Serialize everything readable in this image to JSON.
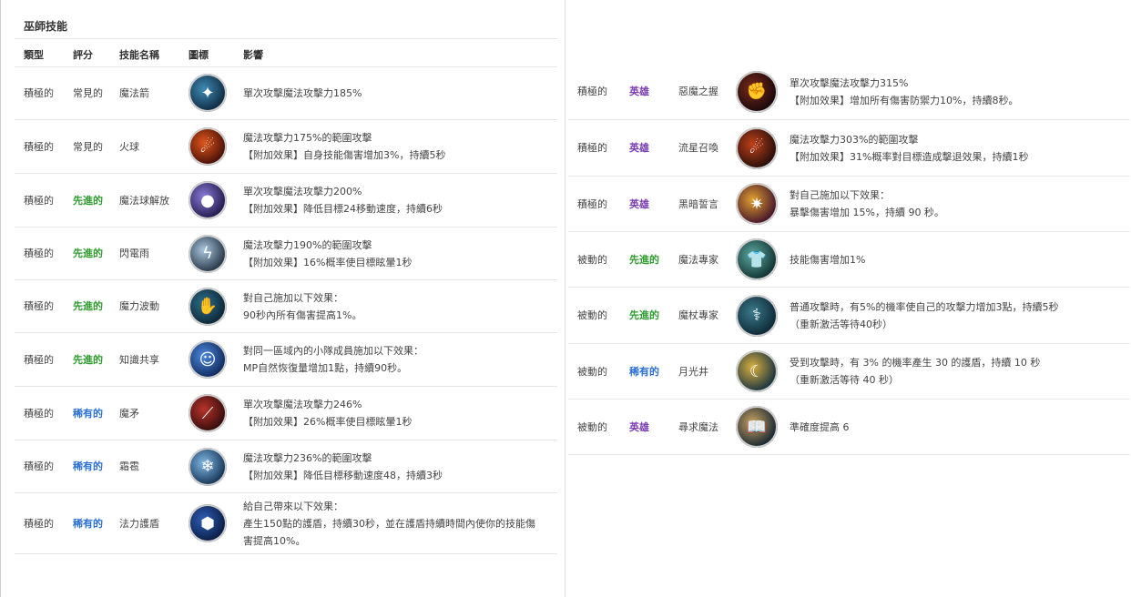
{
  "left": {
    "section_title": "巫師技能",
    "headers": {
      "type": "類型",
      "rating": "評分",
      "name": "技能名稱",
      "icon": "圖標",
      "effect": "影響"
    },
    "rows": [
      {
        "type": "積極的",
        "rarity": "常見的",
        "rarity_class": "common",
        "name": "魔法箭",
        "icon": "magic-arrow-icon",
        "glyph": "✦",
        "colors": [
          "#0c2438",
          "#3d8ab5"
        ],
        "effect": [
          "單次攻擊魔法攻擊力185%"
        ]
      },
      {
        "type": "積極的",
        "rarity": "常見的",
        "rarity_class": "common",
        "name": "火球",
        "icon": "fireball-icon",
        "glyph": "☄",
        "colors": [
          "#3a0a05",
          "#e0561c"
        ],
        "effect": [
          "魔法攻擊力175%的範圍攻擊",
          "【附加效果】自身技能傷害增加3%，持續5秒"
        ]
      },
      {
        "type": "積極的",
        "rarity": "先進的",
        "rarity_class": "advanced",
        "name": "魔法球解放",
        "icon": "magic-orb-release-icon",
        "glyph": "●",
        "colors": [
          "#1a1240",
          "#8a7bd9"
        ],
        "effect": [
          "單次攻擊魔法攻擊力200%",
          "【附加效果】降低目標24移動速度，持續6秒"
        ]
      },
      {
        "type": "積極的",
        "rarity": "先進的",
        "rarity_class": "advanced",
        "name": "閃電雨",
        "icon": "lightning-rain-icon",
        "glyph": "ϟ",
        "colors": [
          "#1b2a3a",
          "#a9c6de"
        ],
        "effect": [
          "魔法攻擊力190%的範圍攻擊",
          "【附加效果】16%概率使目標眩暈1秒"
        ]
      },
      {
        "type": "積極的",
        "rarity": "先進的",
        "rarity_class": "advanced",
        "name": "魔力波動",
        "icon": "mana-wave-icon",
        "glyph": "✋",
        "colors": [
          "#0a2030",
          "#2c6f8a"
        ],
        "effect": [
          "對自己施加以下效果：",
          "90秒內所有傷害提高1%。"
        ]
      },
      {
        "type": "積極的",
        "rarity": "先進的",
        "rarity_class": "advanced",
        "name": "知識共享",
        "icon": "knowledge-share-icon",
        "glyph": "☺",
        "colors": [
          "#0b2250",
          "#4d8ae0"
        ],
        "effect": [
          "對同一區域內的小隊成員施加以下效果：",
          "MP自然恢復量增加1點，持續90秒。"
        ]
      },
      {
        "type": "積極的",
        "rarity": "稀有的",
        "rarity_class": "rare",
        "name": "魔矛",
        "icon": "magic-spear-icon",
        "glyph": "⟋",
        "colors": [
          "#2a0a0a",
          "#b8322a"
        ],
        "effect": [
          "單次攻擊魔法攻擊力246%",
          "【附加效果】26%概率使目標眩暈1秒"
        ]
      },
      {
        "type": "積極的",
        "rarity": "稀有的",
        "rarity_class": "rare",
        "name": "霜雹",
        "icon": "frost-hail-icon",
        "glyph": "❄",
        "colors": [
          "#0e2a4a",
          "#7fb8e6"
        ],
        "effect": [
          "魔法攻擊力236%的範圍攻擊",
          "【附加效果】降低目標移動速度48，持續3秒"
        ]
      },
      {
        "type": "積極的",
        "rarity": "稀有的",
        "rarity_class": "rare",
        "name": "法力護盾",
        "icon": "mana-shield-icon",
        "glyph": "⬢",
        "colors": [
          "#08183a",
          "#2f5fb8"
        ],
        "effect": [
          "給自己帶來以下效果：",
          "產生150點的護盾，持續30秒，並在護盾持續時間內使你的技能傷",
          "害提高10%。"
        ]
      }
    ]
  },
  "right": {
    "rows": [
      {
        "type": "積極的",
        "rarity": "英雄",
        "rarity_class": "hero",
        "name": "惡魔之握",
        "icon": "demon-grip-icon",
        "glyph": "✊",
        "colors": [
          "#12060a",
          "#7a2a1a"
        ],
        "effect": [
          "單次攻擊魔法攻擊力315%",
          "【附加效果】增加所有傷害防禦力10%，持續8秒。"
        ]
      },
      {
        "type": "積極的",
        "rarity": "英雄",
        "rarity_class": "hero",
        "name": "流星召喚",
        "icon": "meteor-summon-icon",
        "glyph": "☄",
        "colors": [
          "#1a0a08",
          "#c0401a"
        ],
        "effect": [
          "魔法攻擊力303%的範圍攻擊",
          "【附加效果】31%概率對目標造成擊退效果，持續1秒"
        ]
      },
      {
        "type": "積極的",
        "rarity": "英雄",
        "rarity_class": "hero",
        "name": "黑暗誓言",
        "icon": "dark-oath-icon",
        "glyph": "✷",
        "colors": [
          "#3a0a2a",
          "#e0a030"
        ],
        "effect": [
          "對自己施加以下效果：",
          "暴擊傷害增加 15%，持續 90 秒。"
        ]
      },
      {
        "type": "被動的",
        "rarity": "先進的",
        "rarity_class": "advanced",
        "name": "魔法專家",
        "icon": "magic-expert-icon",
        "glyph": "👕",
        "colors": [
          "#0a2a2a",
          "#5fa8a0"
        ],
        "effect": [
          "技能傷害增加1%"
        ]
      },
      {
        "type": "被動的",
        "rarity": "先進的",
        "rarity_class": "advanced",
        "name": "魔杖專家",
        "icon": "wand-expert-icon",
        "glyph": "⚕",
        "colors": [
          "#0a2230",
          "#3a7a8a"
        ],
        "effect": [
          "普通攻擊時，有5%的機率使自己的攻擊力增加3點，持續5秒",
          "（重新激活等待40秒）"
        ]
      },
      {
        "type": "被動的",
        "rarity": "稀有的",
        "rarity_class": "rare",
        "name": "月光井",
        "icon": "moonlight-well-icon",
        "glyph": "☾",
        "colors": [
          "#0b2a40",
          "#d9b040"
        ],
        "effect": [
          "受到攻擊時，有 3% 的機率產生 30 的護盾，持續 10 秒",
          "（重新激活等待 40 秒）"
        ]
      },
      {
        "type": "被動的",
        "rarity": "英雄",
        "rarity_class": "hero",
        "name": "尋求魔法",
        "icon": "seek-magic-icon",
        "glyph": "📖",
        "colors": [
          "#0a2030",
          "#c8a060"
        ],
        "effect": [
          "準確度提高 6"
        ]
      }
    ]
  }
}
